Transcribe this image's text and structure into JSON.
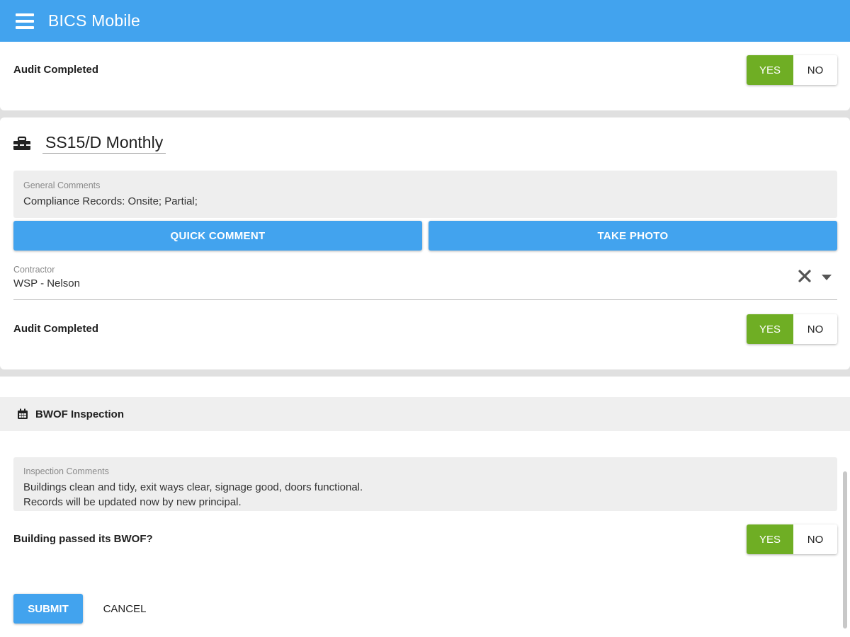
{
  "app": {
    "title": "BICS Mobile"
  },
  "top_card": {
    "audit_label": "Audit Completed",
    "yes": "YES",
    "no": "NO"
  },
  "section": {
    "title": "SS15/D Monthly",
    "general_comments": {
      "label": "General Comments",
      "value": "Compliance Records: Onsite; Partial;"
    },
    "quick_comment": "QUICK COMMENT",
    "take_photo": "TAKE PHOTO",
    "contractor": {
      "label": "Contractor",
      "value": "WSP - Nelson"
    },
    "audit_label": "Audit Completed",
    "yes": "YES",
    "no": "NO"
  },
  "bwof": {
    "header": "BWOF Inspection",
    "inspection_comments": {
      "label": "Inspection Comments",
      "line1": "Buildings clean and tidy, exit ways clear, signage good, doors functional.",
      "line2": "Records will be updated now by new principal."
    },
    "passed_label": "Building passed its BWOF?",
    "yes": "YES",
    "no": "NO",
    "submit": "SUBMIT",
    "cancel": "CANCEL"
  },
  "colors": {
    "primary": "#42a3ee",
    "toggle_selected": "#6fae24"
  },
  "icons": {
    "menu": "hamburger-menu-icon",
    "section": "toolbox-icon",
    "bwof": "calendar-icon",
    "clear": "close-icon",
    "dropdown": "caret-down-icon"
  }
}
